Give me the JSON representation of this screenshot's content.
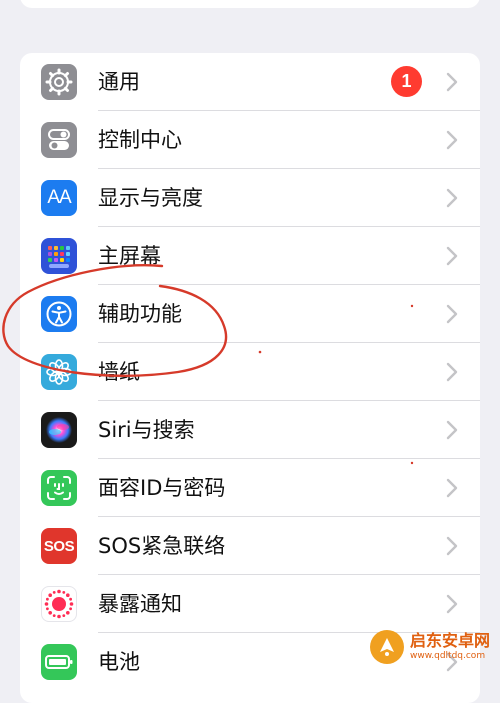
{
  "settings": {
    "items": [
      {
        "label": "通用",
        "icon": "gear-icon",
        "color": "#8e8e93",
        "badge": "1"
      },
      {
        "label": "控制中心",
        "icon": "toggle-icon",
        "color": "#8e8e93"
      },
      {
        "label": "显示与亮度",
        "icon": "text-size-icon",
        "color": "#1c7cf0",
        "icon_text": "AA"
      },
      {
        "label": "主屏幕",
        "icon": "home-grid-icon",
        "color": "#2f52d8"
      },
      {
        "label": "辅助功能",
        "icon": "accessibility-icon",
        "color": "#1c7cf0"
      },
      {
        "label": "墙纸",
        "icon": "flower-icon",
        "color": "#35aadc"
      },
      {
        "label": "Siri与搜索",
        "icon": "siri-icon",
        "color": "#1a1a1a"
      },
      {
        "label": "面容ID与密码",
        "icon": "face-id-icon",
        "color": "#34c759"
      },
      {
        "label": "SOS紧急联络",
        "icon": "sos-icon",
        "color": "#e0362c",
        "icon_text": "SOS"
      },
      {
        "label": "暴露通知",
        "icon": "exposure-icon",
        "color": "#ffffff"
      },
      {
        "label": "电池",
        "icon": "battery-icon",
        "color": "#34c759"
      }
    ]
  },
  "watermark": {
    "title": "启东安卓网",
    "url": "www.qdltdq.com"
  }
}
